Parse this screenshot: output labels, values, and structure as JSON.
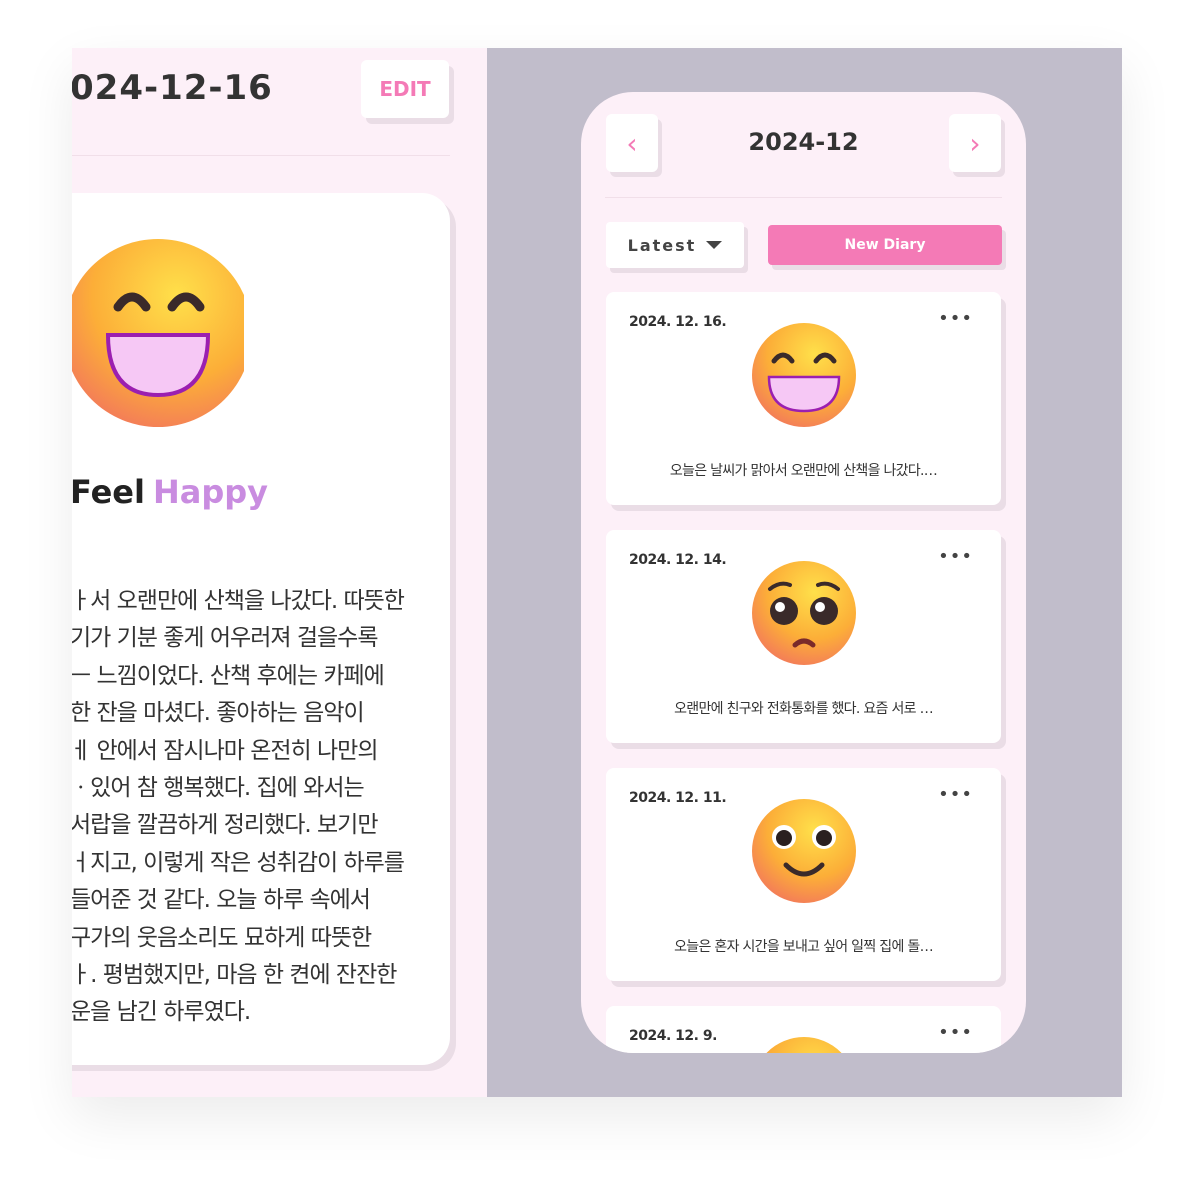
{
  "detail": {
    "date": "024-12-16",
    "edit_label": "EDIT",
    "emotion_icon": "grinning-face-icon",
    "feel_label": "Feel",
    "emotion": "Happy",
    "body_lines": [
      "ㅏ서 오랜만에 산책을 나갔다. 따뜻한",
      "기가 기분 좋게 어우러져 걸을수록",
      "ㅡ 느낌이었다. 산책 후에는 카페에",
      "한 잔을 마셨다. 좋아하는 음악이",
      "ㅔ 안에서 잠시나마 온전히 나만의",
      "ㆍ있어 참 행복했다. 집에 와서는",
      "서랍을 깔끔하게 정리했다. 보기만",
      "ㅓ지고, 이렇게 작은 성취감이 하루를",
      "들어준 것 같다. 오늘 하루 속에서",
      "구가의 웃음소리도 묘하게 따뜻한",
      "ㅏ. 평범했지만, 마음 한 켠에 잔잔한",
      "운을 남긴 하루였다."
    ]
  },
  "list": {
    "prev_icon": "chevron-left-icon",
    "next_icon": "chevron-right-icon",
    "prev": "‹",
    "next": "›",
    "month": "2024-12",
    "sort_label": "Latest",
    "new_label": "New Diary",
    "accent": "#f47ab6",
    "entries": [
      {
        "date": "2024. 12. 16.",
        "emoji": "grinning-face-icon",
        "text": "오늘은 날씨가 맑아서 오랜만에 산책을 나갔다.…",
        "menu": "•••"
      },
      {
        "date": "2024. 12. 14.",
        "emoji": "pleading-face-icon",
        "text": "오랜만에 친구와 전화통화를 했다. 요즘 서로 …",
        "menu": "•••"
      },
      {
        "date": "2024. 12. 11.",
        "emoji": "smiling-face-icon",
        "text": "오늘은 혼자 시간을 보내고 싶어 일찍 집에 돌…",
        "menu": "•••"
      },
      {
        "date": "2024. 12. 9.",
        "emoji": "face-icon",
        "text": "",
        "menu": "•••"
      }
    ]
  }
}
